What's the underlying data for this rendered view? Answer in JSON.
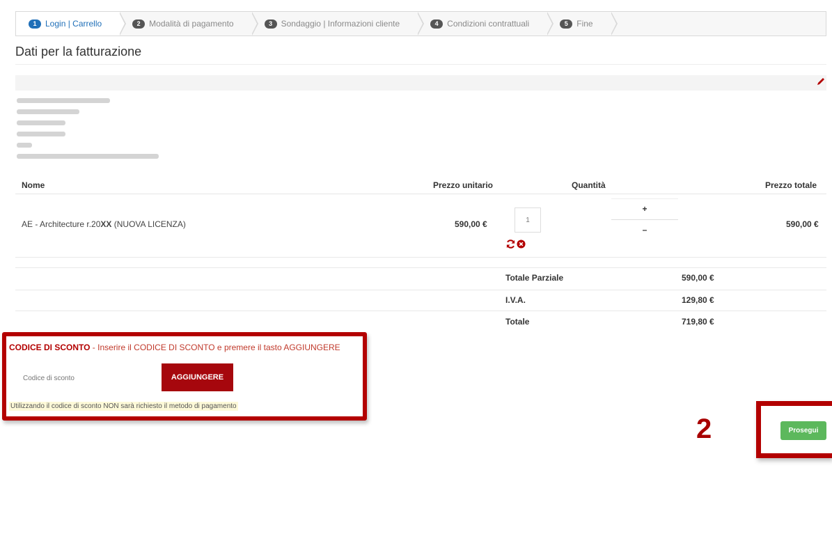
{
  "steps": [
    {
      "num": "1",
      "label": "Login | Carrello",
      "active": true
    },
    {
      "num": "2",
      "label": "Modalità di pagamento"
    },
    {
      "num": "3",
      "label": "Sondaggio | Informazioni cliente"
    },
    {
      "num": "4",
      "label": "Condizioni contrattuali"
    },
    {
      "num": "5",
      "label": "Fine"
    }
  ],
  "billing": {
    "title": "Dati per la fatturazione",
    "edit_icon": "pencil-icon"
  },
  "table": {
    "col_name": "Nome",
    "col_unit_price": "Prezzo unitario",
    "col_quantity": "Quantità",
    "col_total_price": "Prezzo totale",
    "item": {
      "name_prefix": "AE - Architecture r.20",
      "name_bold": "XX",
      "name_suffix": " (NUOVA LICENZA)",
      "unit_price": "590,00 €",
      "quantity": "1",
      "plus": "+",
      "minus": "–",
      "total_price": "590,00 €"
    }
  },
  "summary": {
    "subtotal_label": "Totale Parziale",
    "subtotal_value": "590,00 €",
    "vat_label": "I.V.A.",
    "vat_value": "129,80 €",
    "total_label": "Totale",
    "total_value": "719,80 €"
  },
  "discount": {
    "title": "CODICE DI SCONTO",
    "instruction": " - Inserire il CODICE DI SCONTO e premere il tasto AGGIUNGERE",
    "placeholder": "Codice di sconto",
    "add_button": "AGGIUNGERE",
    "note": "Utilizzando il codice di sconto NON sarà richiesto il metodo di pagamento"
  },
  "annotation_number": "2",
  "next_button": "Prosegui",
  "colors": {
    "accent": "#1f6fb8",
    "highlight_red": "#b30000",
    "add_button": "#a6070d",
    "next_button": "#5cb85c"
  }
}
